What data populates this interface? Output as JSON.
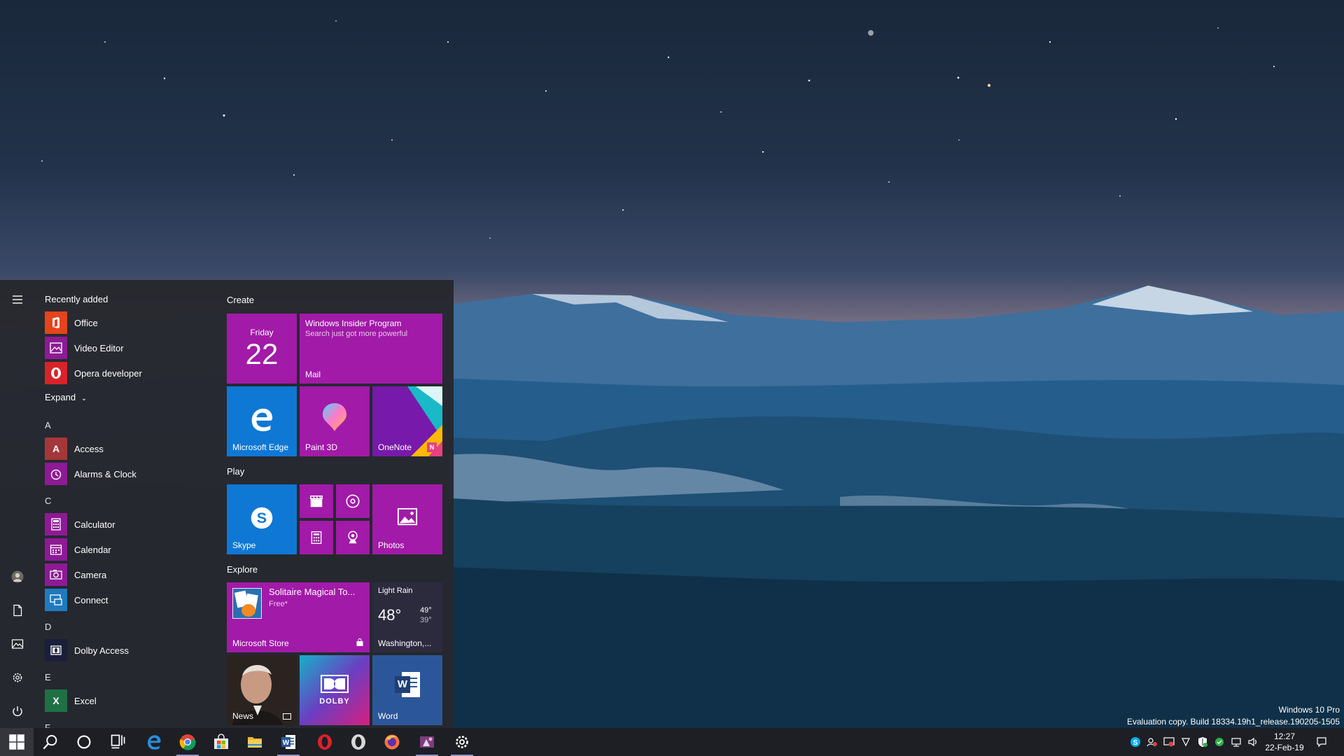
{
  "start_menu": {
    "recently_added_label": "Recently added",
    "recent_apps": [
      {
        "label": "Office",
        "color": "#e3441c"
      },
      {
        "label": "Video Editor",
        "color": "#8e1a95"
      },
      {
        "label": "Opera developer",
        "color": "#d9232a"
      }
    ],
    "expand_label": "Expand",
    "letters": {
      "a": "A",
      "c": "C",
      "d": "D",
      "e": "E",
      "f": "F"
    },
    "apps_a": [
      {
        "label": "Access",
        "color": "#a4373a",
        "glyph": "A"
      },
      {
        "label": "Alarms & Clock",
        "color": "#8e1a95"
      }
    ],
    "apps_c": [
      {
        "label": "Calculator",
        "color": "#8e1a95"
      },
      {
        "label": "Calendar",
        "color": "#8e1a95"
      },
      {
        "label": "Camera",
        "color": "#8e1a95"
      },
      {
        "label": "Connect",
        "color": "#1f7abf"
      }
    ],
    "apps_d": [
      {
        "label": "Dolby Access",
        "color": "#1b1f3b"
      }
    ],
    "apps_e": [
      {
        "label": "Excel",
        "color": "#1f7145",
        "glyph": "X"
      }
    ],
    "groups": {
      "create": "Create",
      "play": "Play",
      "explore": "Explore"
    },
    "tiles": {
      "calendar_day": "Friday",
      "calendar_date": "22",
      "mail_title": "Windows Insider Program",
      "mail_subtitle": "Search just got more powerful",
      "mail_label": "Mail",
      "edge_label": "Microsoft Edge",
      "paint3d_label": "Paint 3D",
      "onenote_label": "OneNote",
      "skype_label": "Skype",
      "photos_label": "Photos",
      "store_app_title": "Solitaire Magical To...",
      "store_app_price": "Free*",
      "store_label": "Microsoft Store",
      "weather_condition": "Light Rain",
      "weather_temp": "48°",
      "weather_high": "49°",
      "weather_low": "39°",
      "weather_location": "Washington,...",
      "news_label": "News",
      "dolby_label": "DOLBY",
      "word_label": "Word"
    }
  },
  "taskbar": {
    "clock_time": "12:27",
    "clock_date": "22-Feb-19",
    "accent_color": "#8f8fc8"
  },
  "watermark": {
    "line1": "Windows 10 Pro",
    "line2": "Evaluation copy. Build 18334.19h1_release.190205-1505"
  },
  "colors": {
    "tile_purple": "#a21aa8",
    "tile_blue": "#0f78d4",
    "menu_bg": "#26282d",
    "taskbar_bg": "#1d1f25"
  }
}
